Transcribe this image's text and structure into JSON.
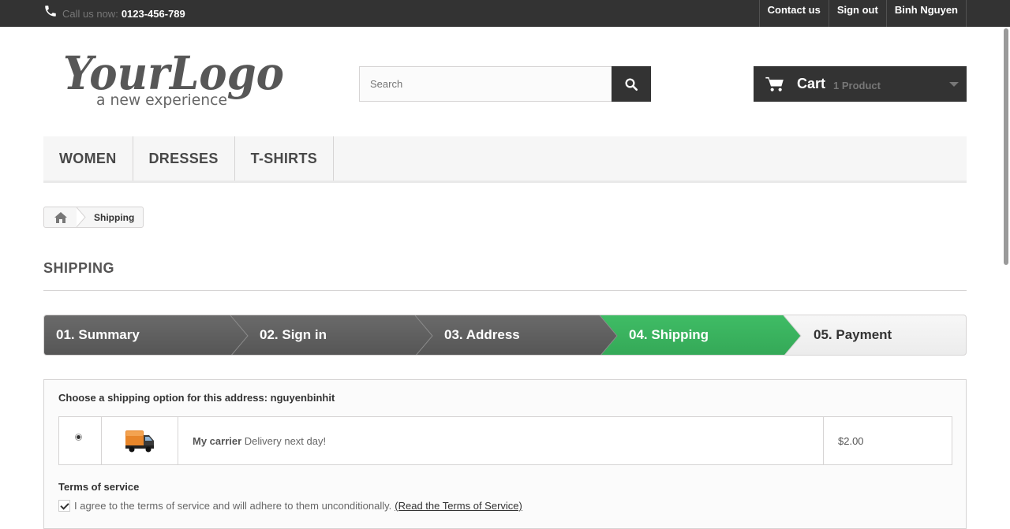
{
  "topbar": {
    "call_label": "Call us now:",
    "phone_number": "0123-456-789",
    "links": [
      "Contact us",
      "Sign out",
      "Binh Nguyen"
    ]
  },
  "logo": {
    "text": "YourLogo",
    "tagline": "a new experience"
  },
  "search": {
    "placeholder": "Search",
    "icon": "search-icon"
  },
  "cart": {
    "title": "Cart",
    "count": "1 Product",
    "icon": "cart-icon"
  },
  "menu": {
    "items": [
      "WOMEN",
      "DRESSES",
      "T-SHIRTS"
    ]
  },
  "breadcrumb": {
    "home_icon": "home-icon",
    "current": "Shipping"
  },
  "page": {
    "heading": "SHIPPING"
  },
  "steps": {
    "items": [
      "01. Summary",
      "02. Sign in",
      "03. Address",
      "04. Shipping",
      "05. Payment"
    ],
    "active_index": 3,
    "colors": {
      "done": "#5f5f5f",
      "active": "#3bb35f",
      "todo": "#efefef"
    }
  },
  "shipping": {
    "choose_text": "Choose a shipping option for this address: nguyenbinhit",
    "carrier": {
      "name": "My carrier",
      "delay": "Delivery next day!",
      "price": "$2.00",
      "icon": "truck-icon",
      "selected": true
    },
    "tos_title": "Terms of service",
    "tos_text": "I agree to the terms of service and will adhere to them unconditionally.",
    "tos_link": "(Read the Terms of Service)",
    "tos_checked": true
  }
}
